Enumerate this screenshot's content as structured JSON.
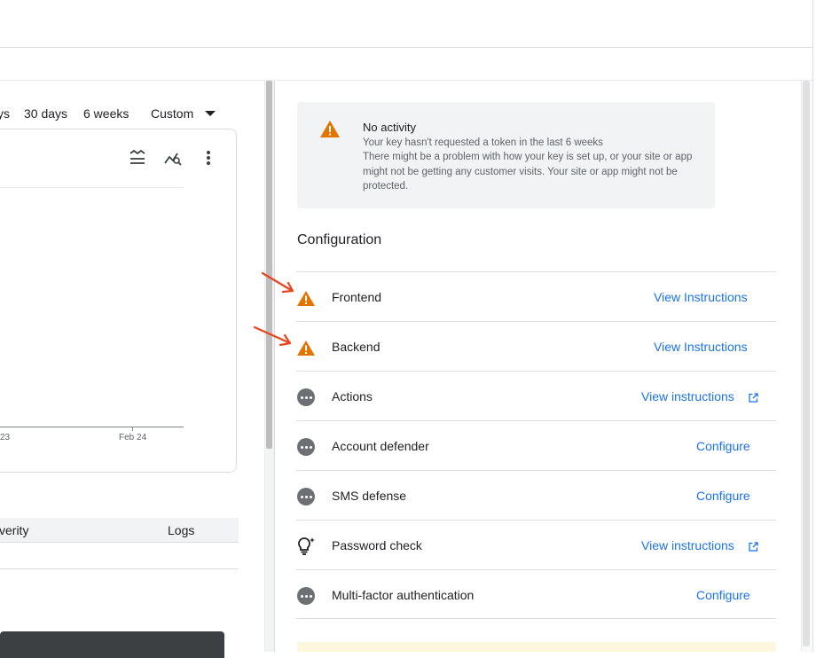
{
  "time_range": {
    "ranges": [
      "ys",
      "30 days",
      "6 weeks"
    ],
    "custom_label": "Custom"
  },
  "chart": {
    "x_labels": [
      "23",
      "Feb 24"
    ]
  },
  "table": {
    "headers": [
      "verity",
      "Logs"
    ]
  },
  "alert": {
    "title": "No activity",
    "body_line1": "Your key hasn't requested a token in the last 6 weeks",
    "body_line2": "There might be a problem with how your key is set up, or your site or app might not be getting any customer visits. Your site or app might not be protected."
  },
  "configuration": {
    "title": "Configuration",
    "items": [
      {
        "label": "Frontend",
        "link": "View Instructions",
        "icon": "warning-icon",
        "external": false
      },
      {
        "label": "Backend",
        "link": "View Instructions",
        "icon": "warning-icon",
        "external": false
      },
      {
        "label": "Actions",
        "link": "View instructions",
        "icon": "more-horizontal-icon",
        "external": true
      },
      {
        "label": "Account defender",
        "link": "Configure",
        "icon": "more-horizontal-icon",
        "external": false
      },
      {
        "label": "SMS defense",
        "link": "Configure",
        "icon": "more-horizontal-icon",
        "external": false
      },
      {
        "label": "Password check",
        "link": "View instructions",
        "icon": "lightbulb-icon",
        "external": true
      },
      {
        "label": "Multi-factor authentication",
        "link": "Configure",
        "icon": "more-horizontal-icon",
        "external": false
      }
    ]
  },
  "colors": {
    "accent": "#1a73e8",
    "warning": "#e37400",
    "annotation_arrow": "#e8441c"
  }
}
